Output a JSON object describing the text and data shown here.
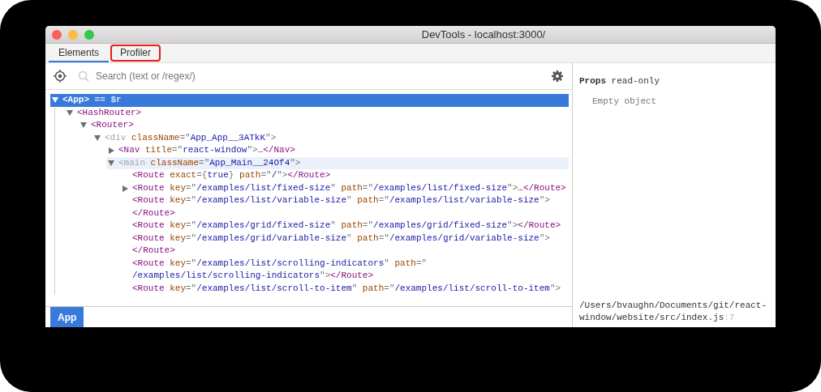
{
  "window": {
    "title": "DevTools - localhost:3000/"
  },
  "tabs": [
    {
      "label": "Elements",
      "selected": true,
      "outlined": false
    },
    {
      "label": "Profiler",
      "selected": false,
      "outlined": true
    }
  ],
  "search": {
    "placeholder": "Search (text or /regex/)"
  },
  "tree": [
    {
      "expanded": true,
      "selected": true,
      "highlighted": false,
      "lines": [
        [
          {
            "kind": "tag",
            "t": "<App>"
          },
          {
            "kind": "plain",
            "t": "==",
            "spaced": true
          },
          {
            "kind": "plain",
            "t": "$r",
            "spaced": true
          }
        ]
      ],
      "children": [
        {
          "expanded": true,
          "selected": false,
          "highlighted": false,
          "lines": [
            [
              {
                "kind": "tag",
                "t": "<HashRouter>"
              }
            ]
          ],
          "children": [
            {
              "expanded": true,
              "selected": false,
              "highlighted": false,
              "lines": [
                [
                  {
                    "kind": "tag",
                    "t": "<Router>"
                  }
                ]
              ],
              "children": [
                {
                  "expanded": true,
                  "selected": false,
                  "highlighted": false,
                  "lines": [
                    [
                      {
                        "kind": "dim",
                        "t": "<div"
                      },
                      {
                        "kind": "attr",
                        "t": "className",
                        "spaced": true
                      },
                      {
                        "kind": "punct",
                        "t": "=\""
                      },
                      {
                        "kind": "value",
                        "t": "App_App__3ATkK"
                      },
                      {
                        "kind": "punct",
                        "t": "\">"
                      }
                    ]
                  ],
                  "children": [
                    {
                      "expanded": false,
                      "selected": false,
                      "highlighted": false,
                      "lines": [
                        [
                          {
                            "kind": "tag",
                            "t": "<Nav"
                          },
                          {
                            "kind": "attr",
                            "t": "title",
                            "spaced": true
                          },
                          {
                            "kind": "punct",
                            "t": "=\""
                          },
                          {
                            "kind": "value",
                            "t": "react-window"
                          },
                          {
                            "kind": "punct",
                            "t": "\">"
                          },
                          {
                            "kind": "plain",
                            "t": "…"
                          },
                          {
                            "kind": "tag",
                            "t": "</Nav>"
                          }
                        ]
                      ]
                    },
                    {
                      "expanded": true,
                      "selected": false,
                      "highlighted": true,
                      "lines": [
                        [
                          {
                            "kind": "dim",
                            "t": "<main"
                          },
                          {
                            "kind": "attr",
                            "t": "className",
                            "spaced": true
                          },
                          {
                            "kind": "punct",
                            "t": "=\""
                          },
                          {
                            "kind": "value",
                            "t": "App_Main__24Of4"
                          },
                          {
                            "kind": "punct",
                            "t": "\">"
                          }
                        ]
                      ],
                      "children": [
                        {
                          "selected": false,
                          "highlighted": false,
                          "lines": [
                            [
                              {
                                "kind": "tag",
                                "t": "<Route"
                              },
                              {
                                "kind": "attr",
                                "t": "exact",
                                "spaced": true
                              },
                              {
                                "kind": "punct",
                                "t": "={"
                              },
                              {
                                "kind": "value",
                                "t": "true"
                              },
                              {
                                "kind": "punct",
                                "t": "}"
                              },
                              {
                                "kind": "attr",
                                "t": "path",
                                "spaced": true
                              },
                              {
                                "kind": "punct",
                                "t": "=\""
                              },
                              {
                                "kind": "value",
                                "t": "/"
                              },
                              {
                                "kind": "punct",
                                "t": "\">"
                              },
                              {
                                "kind": "tag",
                                "t": "</Route>"
                              }
                            ]
                          ]
                        },
                        {
                          "expanded": false,
                          "selected": false,
                          "highlighted": false,
                          "lines": [
                            [
                              {
                                "kind": "tag",
                                "t": "<Route"
                              },
                              {
                                "kind": "attr",
                                "t": "key",
                                "spaced": true
                              },
                              {
                                "kind": "punct",
                                "t": "=\""
                              },
                              {
                                "kind": "value",
                                "t": "/examples/list/fixed-size"
                              },
                              {
                                "kind": "punct",
                                "t": "\""
                              },
                              {
                                "kind": "attr",
                                "t": "path",
                                "spaced": true
                              },
                              {
                                "kind": "punct",
                                "t": "=\""
                              },
                              {
                                "kind": "value",
                                "t": "/examples/list/fixed-size"
                              },
                              {
                                "kind": "punct",
                                "t": "\">"
                              },
                              {
                                "kind": "plain",
                                "t": "…"
                              },
                              {
                                "kind": "tag",
                                "t": "</Route>"
                              }
                            ]
                          ]
                        },
                        {
                          "selected": false,
                          "highlighted": false,
                          "lines": [
                            [
                              {
                                "kind": "tag",
                                "t": "<Route"
                              },
                              {
                                "kind": "attr",
                                "t": "key",
                                "spaced": true
                              },
                              {
                                "kind": "punct",
                                "t": "=\""
                              },
                              {
                                "kind": "value",
                                "t": "/examples/list/variable-size"
                              },
                              {
                                "kind": "punct",
                                "t": "\""
                              },
                              {
                                "kind": "attr",
                                "t": "path",
                                "spaced": true
                              },
                              {
                                "kind": "punct",
                                "t": "=\""
                              },
                              {
                                "kind": "value",
                                "t": "/examples/list/variable-size"
                              },
                              {
                                "kind": "punct",
                                "t": "\">"
                              }
                            ],
                            [
                              {
                                "kind": "tag",
                                "t": "</Route>"
                              }
                            ]
                          ]
                        },
                        {
                          "selected": false,
                          "highlighted": false,
                          "lines": [
                            [
                              {
                                "kind": "tag",
                                "t": "<Route"
                              },
                              {
                                "kind": "attr",
                                "t": "key",
                                "spaced": true
                              },
                              {
                                "kind": "punct",
                                "t": "=\""
                              },
                              {
                                "kind": "value",
                                "t": "/examples/grid/fixed-size"
                              },
                              {
                                "kind": "punct",
                                "t": "\""
                              },
                              {
                                "kind": "attr",
                                "t": "path",
                                "spaced": true
                              },
                              {
                                "kind": "punct",
                                "t": "=\""
                              },
                              {
                                "kind": "value",
                                "t": "/examples/grid/fixed-size"
                              },
                              {
                                "kind": "punct",
                                "t": "\">"
                              },
                              {
                                "kind": "tag",
                                "t": "</Route>"
                              }
                            ]
                          ]
                        },
                        {
                          "selected": false,
                          "highlighted": false,
                          "lines": [
                            [
                              {
                                "kind": "tag",
                                "t": "<Route"
                              },
                              {
                                "kind": "attr",
                                "t": "key",
                                "spaced": true
                              },
                              {
                                "kind": "punct",
                                "t": "=\""
                              },
                              {
                                "kind": "value",
                                "t": "/examples/grid/variable-size"
                              },
                              {
                                "kind": "punct",
                                "t": "\""
                              },
                              {
                                "kind": "attr",
                                "t": "path",
                                "spaced": true
                              },
                              {
                                "kind": "punct",
                                "t": "=\""
                              },
                              {
                                "kind": "value",
                                "t": "/examples/grid/variable-size"
                              },
                              {
                                "kind": "punct",
                                "t": "\">"
                              }
                            ],
                            [
                              {
                                "kind": "tag",
                                "t": "</Route>"
                              }
                            ]
                          ]
                        },
                        {
                          "selected": false,
                          "highlighted": false,
                          "lines": [
                            [
                              {
                                "kind": "tag",
                                "t": "<Route"
                              },
                              {
                                "kind": "attr",
                                "t": "key",
                                "spaced": true
                              },
                              {
                                "kind": "punct",
                                "t": "=\""
                              },
                              {
                                "kind": "value",
                                "t": "/examples/list/scrolling-indicators"
                              },
                              {
                                "kind": "punct",
                                "t": "\""
                              },
                              {
                                "kind": "attr",
                                "t": "path",
                                "spaced": true
                              },
                              {
                                "kind": "punct",
                                "t": "=\""
                              }
                            ],
                            [
                              {
                                "kind": "value",
                                "t": "/examples/list/scrolling-indicators"
                              },
                              {
                                "kind": "punct",
                                "t": "\">"
                              },
                              {
                                "kind": "tag",
                                "t": "</Route>"
                              }
                            ]
                          ]
                        },
                        {
                          "selected": false,
                          "highlighted": false,
                          "lines": [
                            [
                              {
                                "kind": "tag",
                                "t": "<Route"
                              },
                              {
                                "kind": "attr",
                                "t": "key",
                                "spaced": true
                              },
                              {
                                "kind": "punct",
                                "t": "=\""
                              },
                              {
                                "kind": "value",
                                "t": "/examples/list/scroll-to-item"
                              },
                              {
                                "kind": "punct",
                                "t": "\""
                              },
                              {
                                "kind": "attr",
                                "t": "path",
                                "spaced": true
                              },
                              {
                                "kind": "punct",
                                "t": "=\""
                              },
                              {
                                "kind": "value",
                                "t": "/examples/list/scroll-to-item"
                              },
                              {
                                "kind": "punct",
                                "t": "\">"
                              }
                            ]
                          ]
                        }
                      ]
                    }
                  ]
                }
              ]
            }
          ]
        }
      ]
    }
  ],
  "breadcrumbs": [
    {
      "label": "App",
      "selected": true
    }
  ],
  "props": {
    "title": "Props",
    "note": "read-only",
    "empty": "Empty object"
  },
  "source": {
    "path": "/Users/bvaughn/Documents/git/react-window/website/src/index.js",
    "line": ":7"
  }
}
